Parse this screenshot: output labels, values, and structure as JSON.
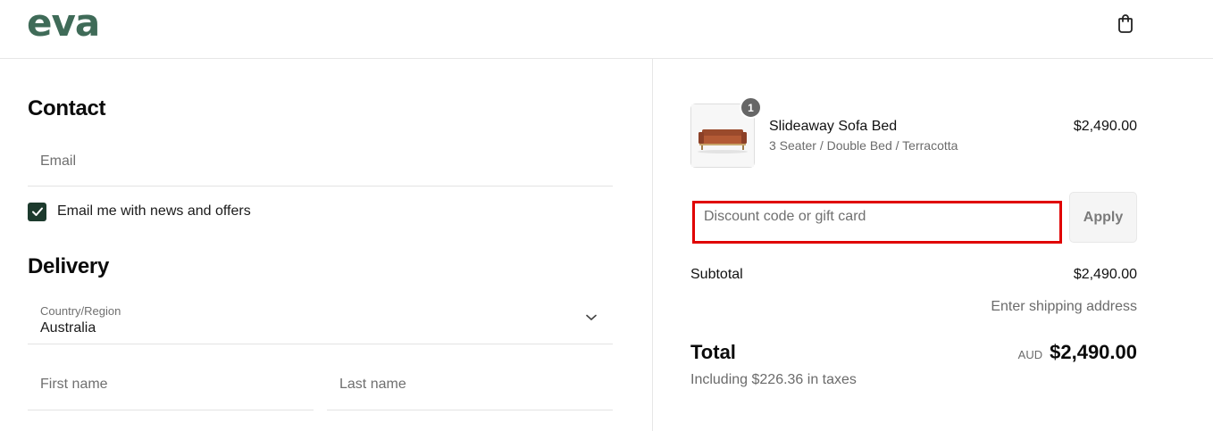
{
  "brand": {
    "logo_text": "eva",
    "color": "#3f6b58"
  },
  "header": {
    "cart_icon": "shopping-bag-icon"
  },
  "contact": {
    "title": "Contact",
    "email_placeholder": "Email",
    "newsletter_label": "Email me with news and offers",
    "newsletter_checked": true
  },
  "delivery": {
    "title": "Delivery",
    "country_label": "Country/Region",
    "country_value": "Australia",
    "first_name_placeholder": "First name",
    "last_name_placeholder": "Last name"
  },
  "summary": {
    "item": {
      "quantity": "1",
      "name": "Slideaway Sofa Bed",
      "variant": "3 Seater / Double Bed / Terracotta",
      "price": "$2,490.00"
    },
    "discount_placeholder": "Discount code or gift card",
    "apply_label": "Apply",
    "subtotal_label": "Subtotal",
    "subtotal_value": "$2,490.00",
    "shipping_note": "Enter shipping address",
    "total_label": "Total",
    "currency": "AUD",
    "total_value": "$2,490.00",
    "tax_note": "Including $226.36 in taxes"
  }
}
